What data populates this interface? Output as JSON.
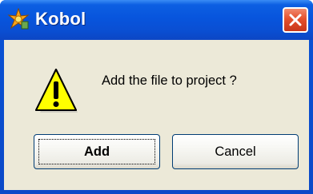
{
  "window": {
    "title": "Kobol",
    "app_icon": "kobol-app-icon",
    "close_icon": "close-icon"
  },
  "dialog": {
    "icon": "warning-icon",
    "message": "Add the file to project ?"
  },
  "buttons": {
    "add_label": "Add",
    "cancel_label": "Cancel"
  },
  "colors": {
    "titlebar": "#0a52d4",
    "close_button": "#e4502d",
    "dialog_background": "#ece9d8",
    "warning_fill": "#ffff00"
  }
}
